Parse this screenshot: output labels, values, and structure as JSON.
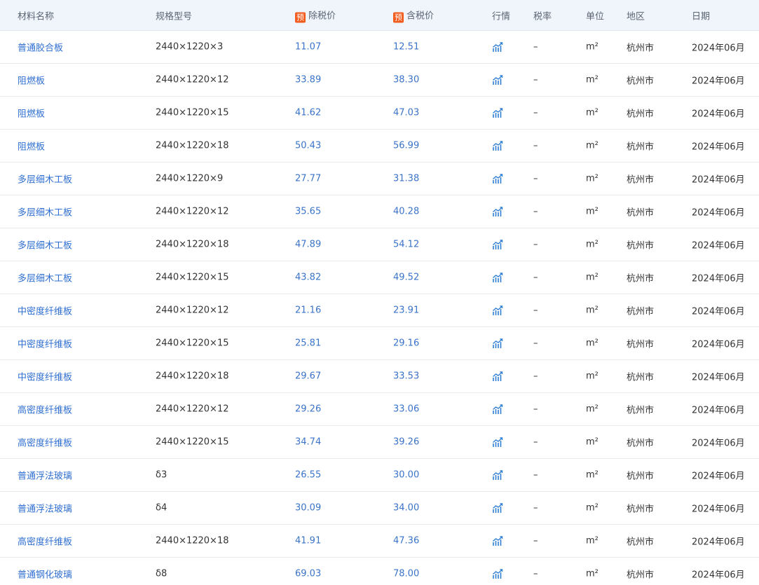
{
  "header": {
    "name": "材料名称",
    "spec": "规格型号",
    "price_pre_badge": "预",
    "price_pre": "除税价",
    "price_inc_badge": "预",
    "price_inc": "含税价",
    "trend": "行情",
    "tax": "税率",
    "unit": "单位",
    "region": "地区",
    "date": "日期"
  },
  "icons": {
    "trend": "trend-chart-icon"
  },
  "colors": {
    "link": "#2f6fd1",
    "badge": "#f35b1c",
    "header_bg": "#f0f5fc"
  },
  "rows": [
    {
      "name": "普通胶合板",
      "spec": "2440×1220×3",
      "pre": "11.07",
      "inc": "12.51",
      "tax": "–",
      "unit": "m²",
      "region": "杭州市",
      "date": "2024年06月"
    },
    {
      "name": "阻燃板",
      "spec": "2440×1220×12",
      "pre": "33.89",
      "inc": "38.30",
      "tax": "–",
      "unit": "m²",
      "region": "杭州市",
      "date": "2024年06月"
    },
    {
      "name": "阻燃板",
      "spec": "2440×1220×15",
      "pre": "41.62",
      "inc": "47.03",
      "tax": "–",
      "unit": "m²",
      "region": "杭州市",
      "date": "2024年06月"
    },
    {
      "name": "阻燃板",
      "spec": "2440×1220×18",
      "pre": "50.43",
      "inc": "56.99",
      "tax": "–",
      "unit": "m²",
      "region": "杭州市",
      "date": "2024年06月"
    },
    {
      "name": "多层细木工板",
      "spec": "2440×1220×9",
      "pre": "27.77",
      "inc": "31.38",
      "tax": "–",
      "unit": "m²",
      "region": "杭州市",
      "date": "2024年06月"
    },
    {
      "name": "多层细木工板",
      "spec": "2440×1220×12",
      "pre": "35.65",
      "inc": "40.28",
      "tax": "–",
      "unit": "m²",
      "region": "杭州市",
      "date": "2024年06月"
    },
    {
      "name": "多层细木工板",
      "spec": "2440×1220×18",
      "pre": "47.89",
      "inc": "54.12",
      "tax": "–",
      "unit": "m²",
      "region": "杭州市",
      "date": "2024年06月"
    },
    {
      "name": "多层细木工板",
      "spec": "2440×1220×15",
      "pre": "43.82",
      "inc": "49.52",
      "tax": "–",
      "unit": "m²",
      "region": "杭州市",
      "date": "2024年06月"
    },
    {
      "name": "中密度纤维板",
      "spec": "2440×1220×12",
      "pre": "21.16",
      "inc": "23.91",
      "tax": "–",
      "unit": "m²",
      "region": "杭州市",
      "date": "2024年06月"
    },
    {
      "name": "中密度纤维板",
      "spec": "2440×1220×15",
      "pre": "25.81",
      "inc": "29.16",
      "tax": "–",
      "unit": "m²",
      "region": "杭州市",
      "date": "2024年06月"
    },
    {
      "name": "中密度纤维板",
      "spec": "2440×1220×18",
      "pre": "29.67",
      "inc": "33.53",
      "tax": "–",
      "unit": "m²",
      "region": "杭州市",
      "date": "2024年06月"
    },
    {
      "name": "高密度纤维板",
      "spec": "2440×1220×12",
      "pre": "29.26",
      "inc": "33.06",
      "tax": "–",
      "unit": "m²",
      "region": "杭州市",
      "date": "2024年06月"
    },
    {
      "name": "高密度纤维板",
      "spec": "2440×1220×15",
      "pre": "34.74",
      "inc": "39.26",
      "tax": "–",
      "unit": "m²",
      "region": "杭州市",
      "date": "2024年06月"
    },
    {
      "name": "普通浮法玻璃",
      "spec": "δ3",
      "pre": "26.55",
      "inc": "30.00",
      "tax": "–",
      "unit": "m²",
      "region": "杭州市",
      "date": "2024年06月"
    },
    {
      "name": "普通浮法玻璃",
      "spec": "δ4",
      "pre": "30.09",
      "inc": "34.00",
      "tax": "–",
      "unit": "m²",
      "region": "杭州市",
      "date": "2024年06月"
    },
    {
      "name": "高密度纤维板",
      "spec": "2440×1220×18",
      "pre": "41.91",
      "inc": "47.36",
      "tax": "–",
      "unit": "m²",
      "region": "杭州市",
      "date": "2024年06月"
    },
    {
      "name": "普通钢化玻璃",
      "spec": "δ8",
      "pre": "69.03",
      "inc": "78.00",
      "tax": "–",
      "unit": "m²",
      "region": "杭州市",
      "date": "2024年06月"
    }
  ]
}
